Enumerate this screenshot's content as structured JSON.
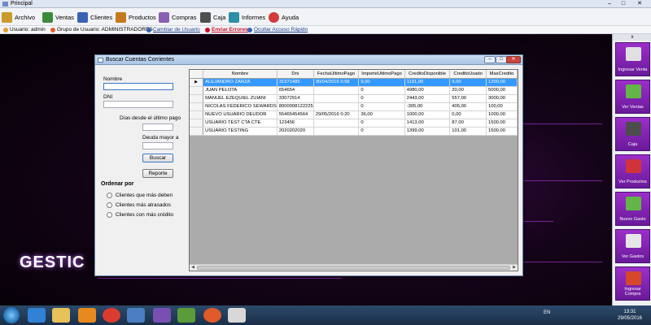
{
  "window": {
    "title": "Principal",
    "controls": [
      "–",
      "□",
      "✕"
    ]
  },
  "menu": {
    "items": [
      {
        "label": "Archivo",
        "icon": "archive-icon",
        "color": "#c99b2b"
      },
      {
        "label": "Ventas",
        "icon": "cart-icon",
        "color": "#3b8a3b"
      },
      {
        "label": "Clientes",
        "icon": "users-icon",
        "color": "#3a63b5"
      },
      {
        "label": "Productos",
        "icon": "box-icon",
        "color": "#c67a1e"
      },
      {
        "label": "Compras",
        "icon": "purchases-icon",
        "color": "#8a5fb3"
      },
      {
        "label": "Caja",
        "icon": "register-icon",
        "color": "#4f4f4f"
      },
      {
        "label": "Informes",
        "icon": "reports-icon",
        "color": "#2b8fa6"
      },
      {
        "label": "Ayuda",
        "icon": "help-icon",
        "color": "#d23b3b"
      }
    ]
  },
  "status": {
    "usuario": "Usuario: admin",
    "grupo": "Grupo de Usuario: ADMINISTRADORES",
    "cambiar": "Cambiar de Usuario",
    "errores": "Enviar Errores",
    "ocultar": "Ocultar Acceso Rápido"
  },
  "background": {
    "brand": "GESTIC"
  },
  "sidebar": {
    "header": "x",
    "buttons": [
      {
        "label": "Ingresar Venta",
        "icon": "pos-terminal-icon",
        "color": "#e0e0e0"
      },
      {
        "label": "Ver Ventas",
        "icon": "cash-icon",
        "color": "#63b547"
      },
      {
        "label": "Caja",
        "icon": "cash-register-icon",
        "color": "#4d4d4d"
      },
      {
        "label": "Ver Productos",
        "icon": "shirt-icon",
        "color": "#d0333a"
      },
      {
        "label": "Nuevo Gasto",
        "icon": "money-icon",
        "color": "#63b547"
      },
      {
        "label": "Ver Gastos",
        "icon": "receipt-icon",
        "color": "#e6e6e6"
      },
      {
        "label": "Ingresar Compra",
        "icon": "truck-icon",
        "color": "#d6472c"
      }
    ]
  },
  "dialog": {
    "title": "Buscar Cuentas Corrientes",
    "controls": [
      "–",
      "□",
      "✕"
    ],
    "nombre_label": "Nombre",
    "nombre_value": "",
    "dni_label": "DNI",
    "dni_value": "",
    "dias_label": "Días desde el último pago",
    "dias_value": "",
    "deuda_label": "Deuda mayor a",
    "deuda_value": "",
    "buscar": "Buscar",
    "reporte": "Reporte",
    "ordenar_label": "Ordenar por",
    "radios": [
      "Clientes que más deben",
      "Clientes más atrasados",
      "Clientes con más crédito"
    ],
    "grid": {
      "columns": [
        "Nombre",
        "Dni",
        "FechaUltimoPago",
        "ImporteUltimoPago",
        "CreditoDisponible",
        "CreditoUsado",
        "MaxCredito"
      ],
      "rows": [
        [
          "ALEJANDRO ZARZA",
          "31971485",
          "30/04/2016 5:58",
          "9,00",
          "1191,00",
          "9,00",
          "1200,00"
        ],
        [
          "JUAN PELOTA",
          "654654",
          "",
          "0",
          "4980,00",
          "20,00",
          "5000,00"
        ],
        [
          "MANUEL EZEQUIEL ZUIANI",
          "33072914",
          "",
          "0",
          "2443,00",
          "557,00",
          "3000,00"
        ],
        [
          "NICOLAS FEDERICO SEWARDS",
          "8000008122225",
          "",
          "0",
          "-305,00",
          "405,00",
          "100,00"
        ],
        [
          "NUEVO USUARIO DEUDOR",
          "55465454564",
          "29/05/2016 0:20",
          "36,00",
          "1000,00",
          "0,00",
          "1000,00"
        ],
        [
          "USUARIO TEST CTA CTE",
          "123456",
          "",
          "0",
          "1413,00",
          "87,00",
          "1500,00"
        ],
        [
          "USUARIO TESTING",
          "2020202020",
          "",
          "0",
          "1399,00",
          "101,00",
          "1500,00"
        ]
      ]
    }
  },
  "taskbar": {
    "lang": "EN",
    "time": "13:31",
    "date": "29/05/2016",
    "apps": [
      "ie-icon",
      "folder-icon",
      "media-player-icon",
      "chrome-icon",
      "network-icon",
      "visual-studio-icon",
      "paint-icon",
      "firefox-icon",
      "gestic-icon"
    ]
  }
}
